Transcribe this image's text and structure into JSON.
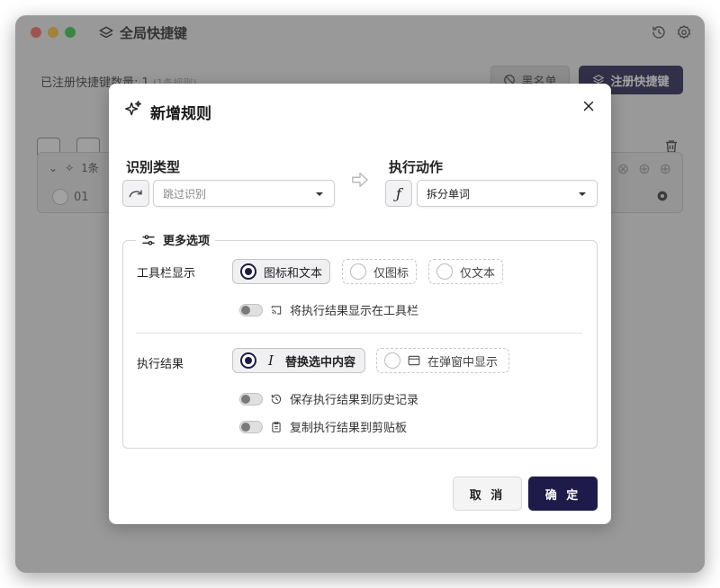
{
  "window": {
    "title": "全局快捷键",
    "toolbar_icons": [
      "history-icon",
      "settings-icon"
    ]
  },
  "background": {
    "count_label": "已注册快捷键数量: 1",
    "count_sub": "(1条规则)",
    "blacklist_label": "黑名单",
    "register_label": "注册快捷键",
    "rule_title": "1条",
    "rule_item": "01"
  },
  "modal": {
    "title": "新增规则",
    "recognition": {
      "label": "识别类型",
      "select_value": "跳过识别"
    },
    "action": {
      "label": "执行动作",
      "select_value": "拆分单词"
    },
    "more_options": {
      "legend": "更多选项",
      "toolbar_display": {
        "label": "工具栏显示",
        "options": [
          "图标和文本",
          "仅图标",
          "仅文本"
        ],
        "selected": "图标和文本"
      },
      "toggle_show_in_toolbar": "将执行结果显示在工具栏",
      "exec_result": {
        "label": "执行结果",
        "options": [
          "替换选中内容",
          "在弹窗中显示"
        ],
        "selected": "替换选中内容"
      },
      "toggle_save_history": "保存执行结果到历史记录",
      "toggle_copy_clipboard": "复制执行结果到剪贴板"
    },
    "cancel_label": "取 消",
    "confirm_label": "确 定"
  },
  "colors": {
    "accent": "#1e1b4b",
    "overlay": "#6e6e6e"
  }
}
